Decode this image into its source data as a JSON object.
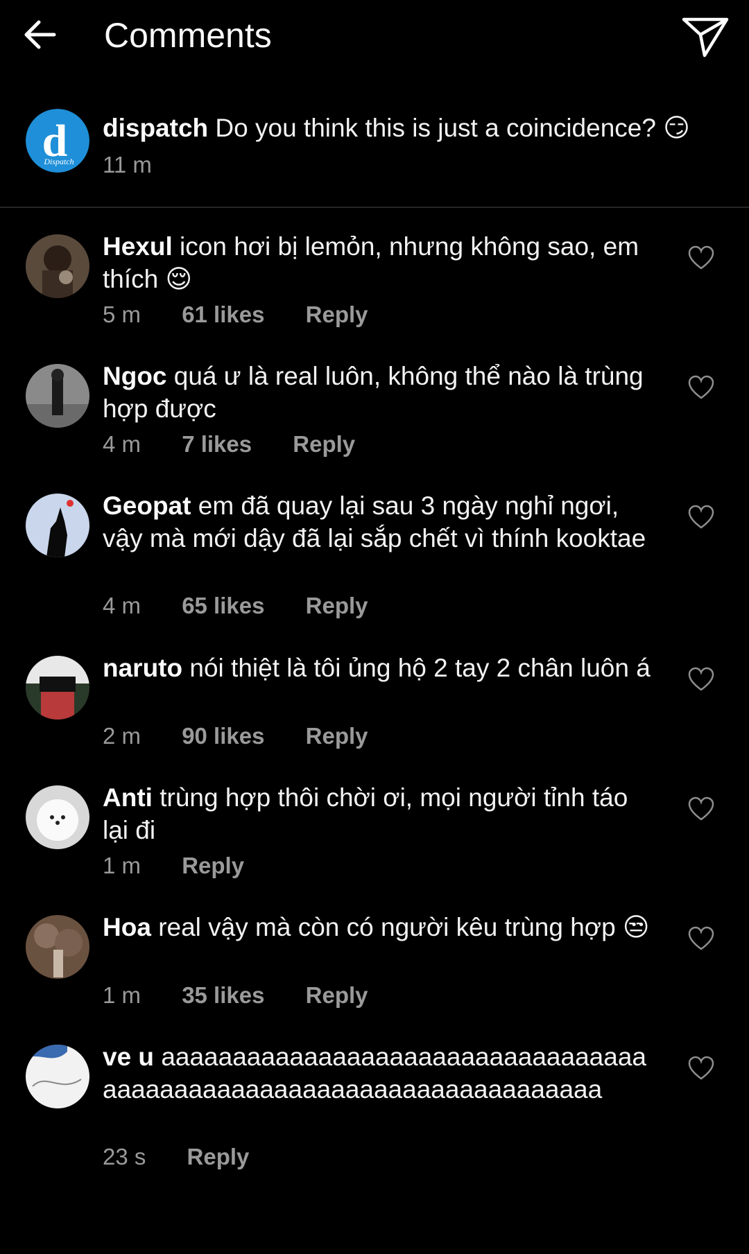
{
  "header": {
    "title": "Comments",
    "back_icon": "arrow-left-icon",
    "send_icon": "paper-plane-icon"
  },
  "caption": {
    "username": "dispatch",
    "text": "Do you think this is just a coincidence? 😏",
    "time": "11 m"
  },
  "comments": [
    {
      "username": "Hexul",
      "text": "icon hơi bị lemỏn, nhưng không sao, em thích 😌",
      "time": "5 m",
      "likes": "61 likes",
      "reply": "Reply"
    },
    {
      "username": "Ngoc",
      "text": "quá ư là real luôn, không thể nào là trùng hợp được",
      "time": "4 m",
      "likes": "7 likes",
      "reply": "Reply"
    },
    {
      "username": "Geopat",
      "text": "em đã quay lại sau 3 ngày nghỉ ngơi, vậy mà mới dậy đã lại sắp chết vì thính kooktae",
      "time": "4 m",
      "likes": "65 likes",
      "reply": "Reply"
    },
    {
      "username": "naruto",
      "text": "nói thiệt là tôi ủng hộ 2 tay 2 chân luôn á",
      "time": "2 m",
      "likes": "90 likes",
      "reply": "Reply"
    },
    {
      "username": "Anti",
      "text": "trùng hợp thôi chời ơi, mọi người tỉnh táo lại đi",
      "time": "1 m",
      "likes": "",
      "reply": "Reply"
    },
    {
      "username": "Hoa",
      "text": "real vậy mà còn có người kêu trùng hợp 😒",
      "time": "1 m",
      "likes": "35 likes",
      "reply": "Reply"
    },
    {
      "username": "ve u",
      "text": "aaaaaaaaaaaaaaaaaaaaaaaaaaaaaaaaaaaaaaaaaaaaaaaaaaaaaaaaaaaaaaaaaaaaa",
      "time": "23 s",
      "likes": "",
      "reply": "Reply"
    }
  ],
  "colors": {
    "background": "#000000",
    "text": "#f5f5f5",
    "secondary": "#9a9a9a",
    "divider": "#262626",
    "dispatch_blue": "#1e8fd8"
  }
}
